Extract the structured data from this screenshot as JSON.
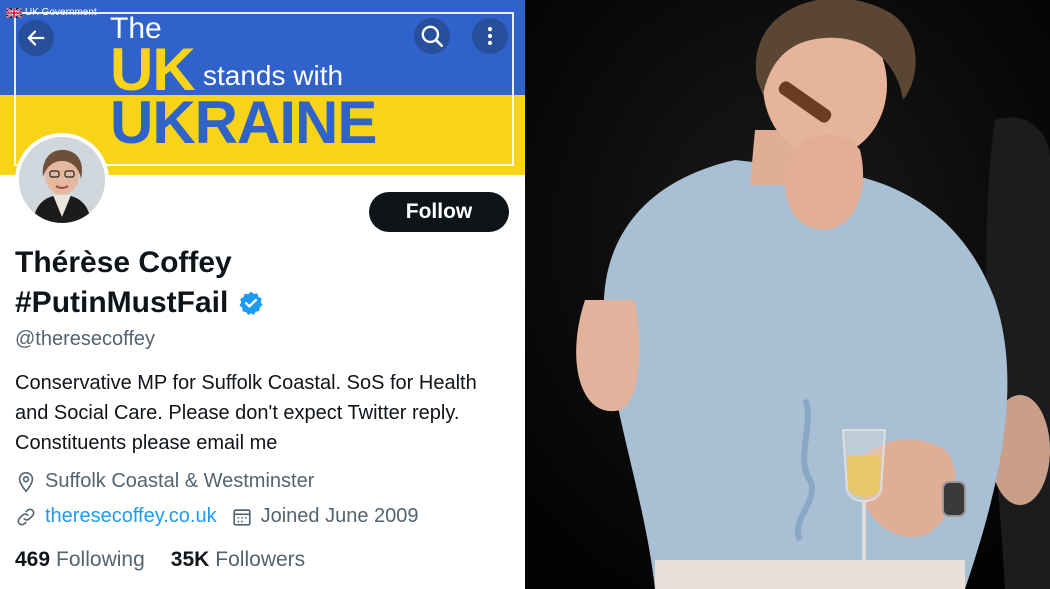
{
  "banner": {
    "gov_tag": "UK Government",
    "line1": "The",
    "line2": "UK",
    "line3": "stands with",
    "line4": "UKRAINE",
    "colors": {
      "blue": "#2f63c9",
      "yellow": "#f7d417"
    }
  },
  "toolbar": {
    "back_icon": "arrow-left-icon",
    "search_icon": "search-icon",
    "more_icon": "more-vertical-icon"
  },
  "profile": {
    "follow_label": "Follow",
    "name_line1": "Thérèse Coffey",
    "name_line2": "#PutinMustFail",
    "verified_icon": "verified-badge-icon",
    "handle": "@theresecoffey",
    "bio": "Conservative MP for Suffolk Coastal. SoS for Health and Social Care. Please don't expect Twitter reply. Constituents please email me",
    "location": "Suffolk Coastal & Westminster",
    "website": "theresecoffey.co.uk",
    "joined": "Joined June 2009",
    "following_count": "469",
    "following_label": "Following",
    "followers_count": "35K",
    "followers_label": "Followers",
    "accent": "#1d9bf0"
  }
}
